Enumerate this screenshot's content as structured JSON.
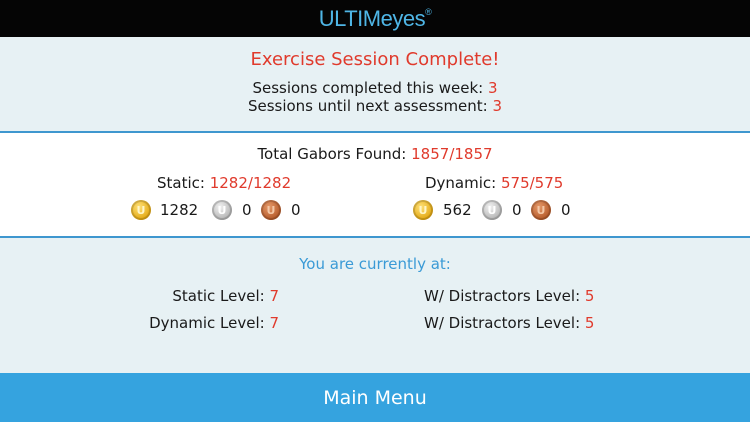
{
  "header": {
    "logo_text": "ULTIMeyes",
    "logo_mark": "®"
  },
  "session": {
    "title": "Exercise Session Complete!",
    "week_label": "Sessions completed this week: ",
    "week_value": "3",
    "next_label": "Sessions until next assessment: ",
    "next_value": "3"
  },
  "gabors": {
    "total_label": "Total Gabors Found: ",
    "total_value": "1857/1857",
    "static": {
      "label": "Static: ",
      "value": "1282/1282",
      "gold": "1282",
      "silver": "0",
      "bronze": "0"
    },
    "dynamic": {
      "label": "Dynamic: ",
      "value": "575/575",
      "gold": "562",
      "silver": "0",
      "bronze": "0"
    }
  },
  "levels": {
    "heading": "You are currently at:",
    "static_label": "Static Level: ",
    "static_value": "7",
    "dynamic_label": "Dynamic Level: ",
    "dynamic_value": "7",
    "static_distractors_label": "W/ Distractors Level: ",
    "static_distractors_value": "5",
    "dynamic_distractors_label": "W/ Distractors Level: ",
    "dynamic_distractors_value": "5"
  },
  "footer": {
    "main_menu_label": "Main Menu"
  },
  "icons": {
    "gold": "gold-medal-icon",
    "silver": "silver-medal-icon",
    "bronze": "bronze-medal-icon",
    "medal_glyph": "U"
  },
  "colors": {
    "accent_red": "#e03a2c",
    "accent_blue": "#35a3df",
    "panel_bg": "#e7f1f4"
  }
}
